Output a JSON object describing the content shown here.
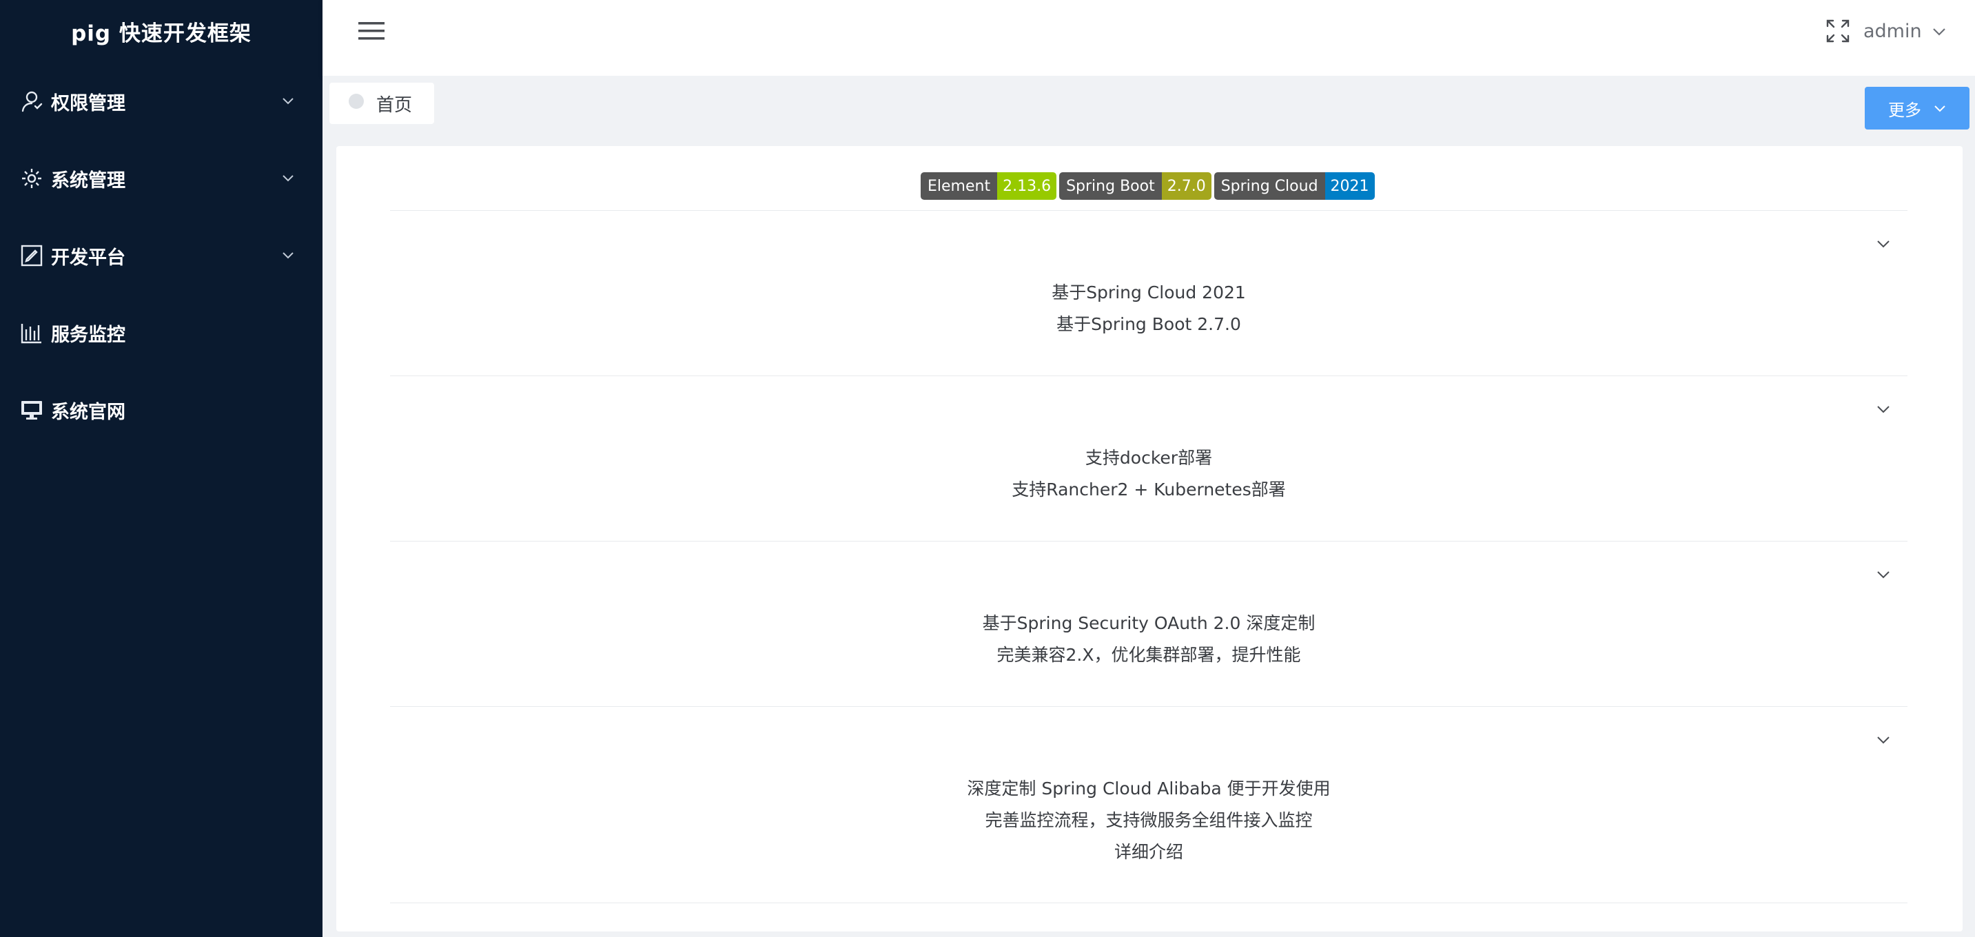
{
  "brand": {
    "title": "pig 快速开发框架"
  },
  "sidebar": {
    "items": [
      {
        "label": "权限管理",
        "icon": "user-icon",
        "expandable": true
      },
      {
        "label": "系统管理",
        "icon": "gear-icon",
        "expandable": true
      },
      {
        "label": "开发平台",
        "icon": "edit-icon",
        "expandable": true
      },
      {
        "label": "服务监控",
        "icon": "chart-icon",
        "expandable": false
      },
      {
        "label": "系统官网",
        "icon": "monitor-icon",
        "expandable": false
      }
    ]
  },
  "header": {
    "hamburger_icon": "hamburger-icon",
    "fullscreen_icon": "fullscreen-icon",
    "user": {
      "name": "admin"
    }
  },
  "tabs": {
    "items": [
      {
        "label": "首页"
      }
    ],
    "more_label": "更多"
  },
  "badges": [
    {
      "key": "Element",
      "value": "2.13.6",
      "color": "#97ca00"
    },
    {
      "key": "Spring Boot",
      "value": "2.7.0",
      "color": "#a4a61d"
    },
    {
      "key": "Spring Cloud",
      "value": "2021",
      "color": "#007ec6"
    }
  ],
  "features": [
    {
      "lines": [
        "基于Spring Cloud 2021",
        "基于Spring Boot 2.7.0"
      ]
    },
    {
      "lines": [
        "支持docker部署",
        "支持Rancher2 + Kubernetes部署"
      ]
    },
    {
      "lines": [
        "基于Spring Security OAuth 2.0 深度定制",
        "完美兼容2.X，优化集群部署，提升性能"
      ]
    },
    {
      "lines": [
        "深度定制 Spring Cloud Alibaba 便于开发使用",
        "完善监控流程，支持微服务全组件接入监控",
        "详细介绍"
      ]
    }
  ],
  "colors": {
    "sidebar_bg": "#0a1a2f",
    "accent": "#4e9ff8"
  }
}
